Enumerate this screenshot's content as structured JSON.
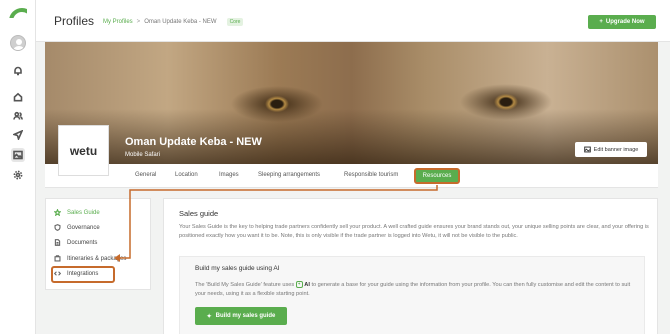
{
  "header": {
    "title": "Profiles",
    "breadcrumb": {
      "link": "My Profiles",
      "separator": ">",
      "current": "Oman Update Keba - NEW",
      "badge": "Core"
    },
    "upgrade_label": "Upgrade Now"
  },
  "rail": {
    "icons": [
      "home-icon",
      "users-icon",
      "send-icon",
      "image-icon",
      "settings-icon"
    ]
  },
  "banner": {
    "logo_text": "wetu",
    "name": "Oman Update Keba - NEW",
    "subtitle": "Mobile Safari",
    "edit_label": "Edit banner image"
  },
  "tabs": [
    "General",
    "Location",
    "Images",
    "Sleeping arrangements",
    "Responsible tourism",
    "Resources"
  ],
  "active_tab": "Resources",
  "sidenav": {
    "items": [
      {
        "label": "Sales Guide",
        "icon": "star-icon",
        "active": true
      },
      {
        "label": "Governance",
        "icon": "shield-icon",
        "active": false
      },
      {
        "label": "Documents",
        "icon": "document-icon",
        "active": false
      },
      {
        "label": "Itineraries & packages",
        "icon": "package-icon",
        "active": false
      },
      {
        "label": "Integrations",
        "icon": "code-icon",
        "active": false
      }
    ]
  },
  "main": {
    "title": "Sales guide",
    "description": "Your Sales Guide is the key to helping trade partners confidently sell your product. A well crafted guide ensures your brand stands out, your unique selling points are clear, and your offering is positioned exactly how you want it to be. Note, this is only visible if the trade partner is logged into Wetu, it will not be visible to the public.",
    "card": {
      "title": "Build my sales guide using AI",
      "desc_before": "The 'Build My Sales Guide' feature uses",
      "ai_label": "AI",
      "desc_after": "to generate a base for your guide using the information from your profile. You can then fully customise and edit the content to suit your needs, using it as a flexible starting point.",
      "button_label": "Build my sales guide"
    }
  },
  "colors": {
    "accent": "#5aad4e",
    "annotation": "#c66b2c"
  }
}
